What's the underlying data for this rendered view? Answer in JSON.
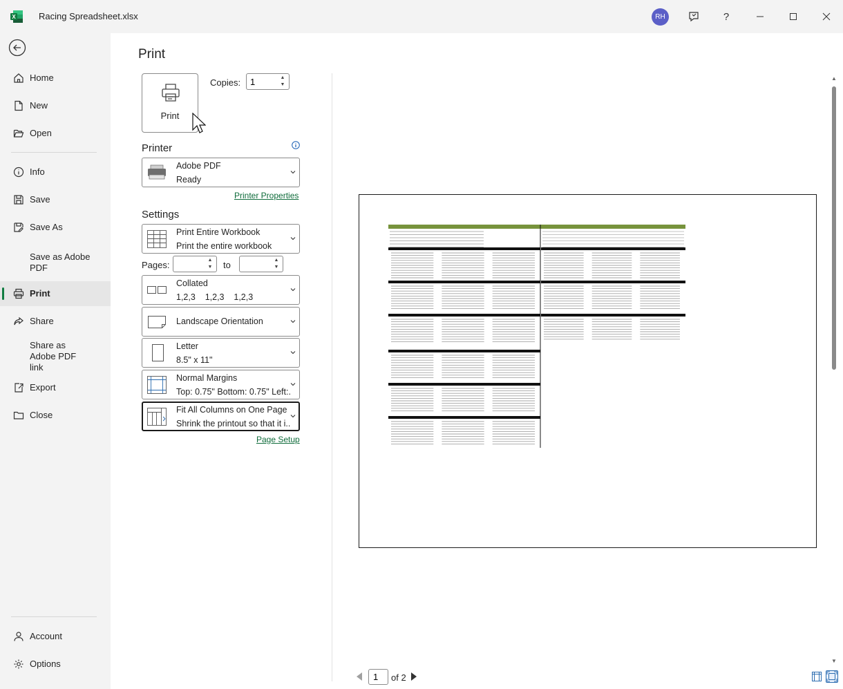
{
  "window": {
    "title": "Racing Spreadsheet.xlsx",
    "user_initials": "RH",
    "app_icon": "excel-logo-icon",
    "controls": [
      "feedback-icon",
      "help-icon",
      "minimize-icon",
      "maximize-icon",
      "close-icon"
    ],
    "help_glyph": "?"
  },
  "sidebar": {
    "back_icon": "back-arrow-icon",
    "items": [
      {
        "label": "Home",
        "icon": "home-icon"
      },
      {
        "label": "New",
        "icon": "new-document-icon"
      },
      {
        "label": "Open",
        "icon": "folder-open-icon"
      },
      {
        "label": "Info",
        "icon": "info-icon"
      },
      {
        "label": "Save",
        "icon": "save-icon"
      },
      {
        "label": "Save As",
        "icon": "save-as-icon"
      },
      {
        "label": "Save as Adobe PDF",
        "icon": ""
      },
      {
        "label": "Print",
        "icon": "print-icon",
        "active": true
      },
      {
        "label": "Share",
        "icon": "share-icon"
      },
      {
        "label": "Share as Adobe PDF link",
        "icon": ""
      },
      {
        "label": "Export",
        "icon": "export-icon"
      },
      {
        "label": "Close",
        "icon": "close-folder-icon"
      },
      {
        "label": "Account",
        "icon": "account-icon"
      },
      {
        "label": "Options",
        "icon": "gear-icon"
      }
    ],
    "accent_color": "#107c41"
  },
  "print": {
    "title": "Print",
    "print_button_label": "Print",
    "copies_label": "Copies:",
    "copies_value": "1",
    "printer_heading": "Printer",
    "printer": {
      "name": "Adobe PDF",
      "status": "Ready"
    },
    "printer_properties_link": "Printer Properties",
    "settings_heading": "Settings",
    "settings": {
      "scope": {
        "line1": "Print Entire Workbook",
        "line2": "Print the entire workbook"
      },
      "pages_label": "Pages:",
      "pages_from": "",
      "pages_to_label": "to",
      "pages_to": "",
      "collation": {
        "line1": "Collated",
        "line2": "1,2,3    1,2,3    1,2,3"
      },
      "orientation": "Landscape Orientation",
      "paper": {
        "line1": "Letter",
        "line2": "8.5\" x 11\""
      },
      "margins": {
        "line1": "Normal Margins",
        "line2": "Top: 0.75\" Bottom: 0.75\" Left:..."
      },
      "scaling": {
        "line1": "Fit All Columns on One Page",
        "line2": "Shrink the printout so that it i..."
      }
    },
    "page_setup_link": "Page Setup",
    "link_color": "#0e6b3a"
  },
  "preview": {
    "current_page": "1",
    "of_total": "of 2",
    "header_color": "#77933c"
  }
}
